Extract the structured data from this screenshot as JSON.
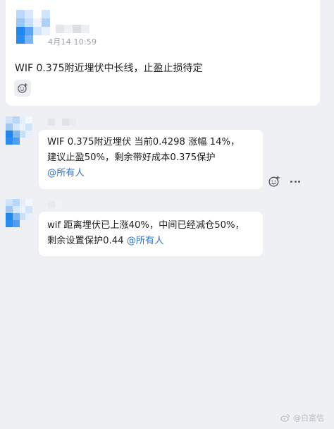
{
  "post": {
    "time": "4月14 10:59",
    "text": "WIF 0.375附近埋伏中长线，止盈止损待定"
  },
  "messages": [
    {
      "lines": [
        "WIF 0.375附近埋伏 当前0.4298 涨幅 14%，",
        "建议止盈50%，剩余带好成本0.375保护"
      ],
      "mention": "@所有人"
    },
    {
      "lines": [
        "wif 距离埋伏已上涨40%，中间已经减仓50%，",
        "剩余设置保护0.44 "
      ],
      "mention": "@所有人"
    }
  ],
  "watermark": {
    "text": "@白富信"
  },
  "icons": {
    "reaction": "emoji-add-icon",
    "more": "more-dots-icon",
    "watermark_logo": "weibo-logo-icon"
  },
  "colors": {
    "background": "#eef0f3",
    "card": "#ffffff",
    "mention": "#2f74d0",
    "timestamp": "#9aa1a9",
    "avatar_blue": "#1f86ef"
  }
}
